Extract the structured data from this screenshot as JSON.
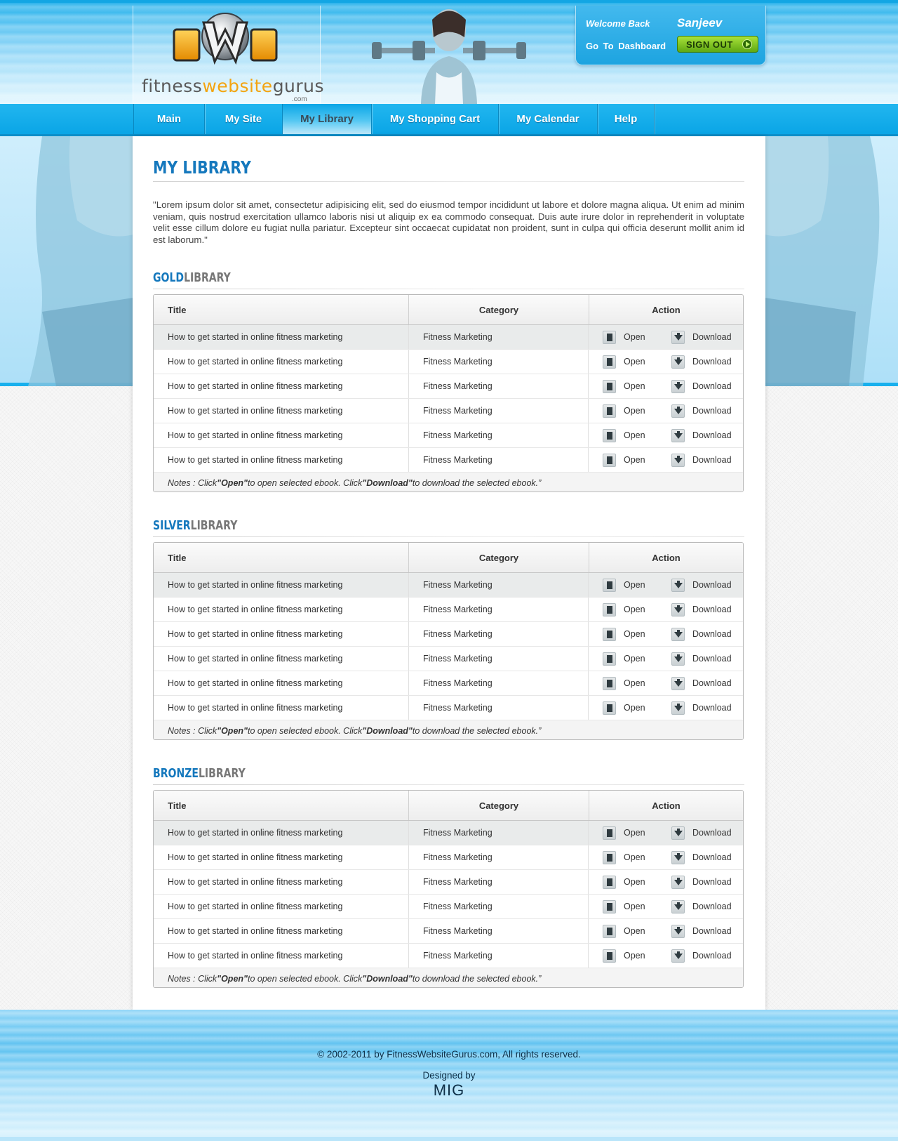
{
  "header": {
    "logo_text": {
      "start": "fitness",
      "middle": "website",
      "end": "gurus"
    },
    "logo_suffix": ".com",
    "logo_mark": "FWG",
    "welcome_label": "Welcome Back",
    "username": "Sanjeev",
    "dashboard_link": "Go To Dashboard",
    "signout_label": "SIGN OUT"
  },
  "nav": {
    "items": [
      {
        "label": "Main"
      },
      {
        "label": "My Site"
      },
      {
        "label": "My Library"
      },
      {
        "label": "My Shopping Cart"
      },
      {
        "label": "My Calendar"
      },
      {
        "label": "Help"
      }
    ],
    "active": "My Library"
  },
  "page": {
    "title": "MY LIBRARY",
    "intro": "\"Lorem ipsum dolor sit amet, consectetur adipisicing elit, sed do eiusmod tempor incididunt ut labore et dolore magna aliqua. Ut enim ad minim veniam, quis nostrud exercitation ullamco laboris nisi ut aliquip ex ea commodo consequat. Duis aute irure dolor in reprehenderit in voluptate velit esse cillum dolore eu fugiat nulla pariatur. Excepteur sint occaecat cupidatat non proident, sunt in culpa qui officia deserunt mollit anim id est laborum.\""
  },
  "table_headers": {
    "title": "Title",
    "category": "Category",
    "action": "Action"
  },
  "actions": {
    "open": "Open",
    "download": "Download"
  },
  "note": {
    "prefix": "Notes : Click ",
    "open": "\"Open\"",
    "middle": " to open selected ebook. Click ",
    "download": "\"Download\"",
    "suffix": " to download the selected ebook.”"
  },
  "libraries": [
    {
      "level": "GOLD",
      "word": "LIBRARY",
      "rows": [
        {
          "title": "How to get started in online fitness marketing",
          "category": "Fitness Marketing"
        },
        {
          "title": "How to get started in online fitness marketing",
          "category": "Fitness Marketing"
        },
        {
          "title": "How to get started in online fitness marketing",
          "category": "Fitness Marketing"
        },
        {
          "title": "How to get started in online fitness marketing",
          "category": "Fitness Marketing"
        },
        {
          "title": "How to get started in online fitness marketing",
          "category": "Fitness Marketing"
        },
        {
          "title": "How to get started in online fitness marketing",
          "category": "Fitness Marketing"
        }
      ]
    },
    {
      "level": "SILVER",
      "word": "LIBRARY",
      "rows": [
        {
          "title": "How to get started in online fitness marketing",
          "category": "Fitness Marketing"
        },
        {
          "title": "How to get started in online fitness marketing",
          "category": "Fitness Marketing"
        },
        {
          "title": "How to get started in online fitness marketing",
          "category": "Fitness Marketing"
        },
        {
          "title": "How to get started in online fitness marketing",
          "category": "Fitness Marketing"
        },
        {
          "title": "How to get started in online fitness marketing",
          "category": "Fitness Marketing"
        },
        {
          "title": "How to get started in online fitness marketing",
          "category": "Fitness Marketing"
        }
      ]
    },
    {
      "level": "BRONZE",
      "word": "LIBRARY",
      "rows": [
        {
          "title": "How to get started in online fitness marketing",
          "category": "Fitness Marketing"
        },
        {
          "title": "How to get started in online fitness marketing",
          "category": "Fitness Marketing"
        },
        {
          "title": "How to get started in online fitness marketing",
          "category": "Fitness Marketing"
        },
        {
          "title": "How to get started in online fitness marketing",
          "category": "Fitness Marketing"
        },
        {
          "title": "How to get started in online fitness marketing",
          "category": "Fitness Marketing"
        },
        {
          "title": "How to get started in online fitness marketing",
          "category": "Fitness Marketing"
        }
      ]
    }
  ],
  "footer": {
    "copyright": "© 2002-2011 by FitnessWebsiteGurus.com, All rights reserved.",
    "designed_by": "Designed by",
    "designer": "MIG"
  },
  "colors": {
    "accent_blue": "#1578bd",
    "nav_blue": "#0aa5e6",
    "signout_green": "#7cc31f",
    "logo_orange": "#f3a411"
  },
  "icons": {
    "open": "document-icon",
    "download": "download-arrow-icon",
    "signout": "arrow-circle-icon"
  }
}
